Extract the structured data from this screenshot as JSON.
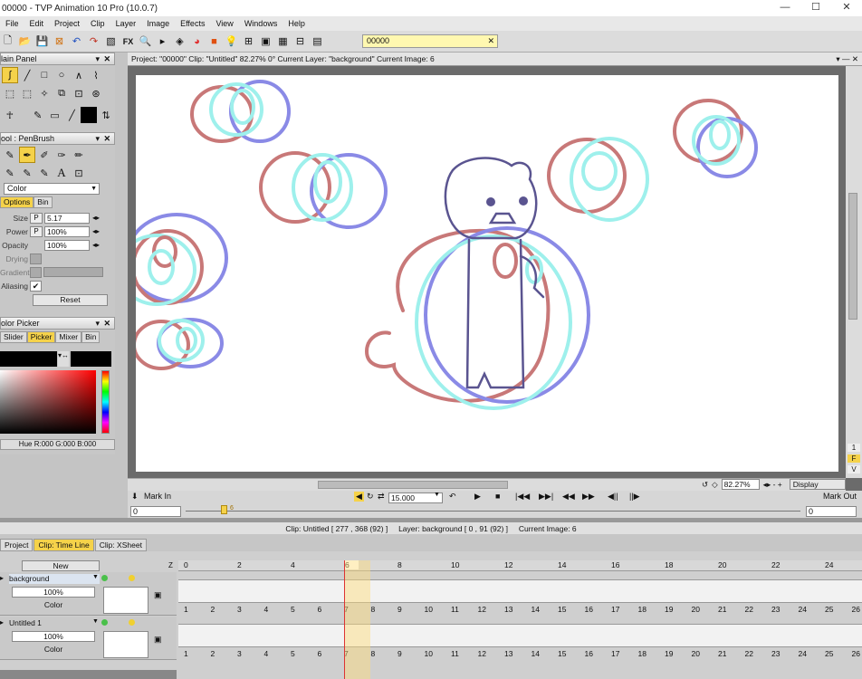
{
  "window": {
    "title": "00000 - TVP Animation 10 Pro (10.0.7)"
  },
  "menu": [
    "File",
    "Edit",
    "Project",
    "Clip",
    "Layer",
    "Image",
    "Effects",
    "View",
    "Windows",
    "Help"
  ],
  "toolbar": {
    "fx_label": "FX",
    "project_field": "00000"
  },
  "main_panel": {
    "title": "lain Panel"
  },
  "tool_panel": {
    "title": "ool : PenBrush",
    "color_mode": "Color",
    "tabs": [
      "Options",
      "Bin"
    ],
    "options": {
      "size_label": "Size",
      "size_value": "5.17",
      "power_label": "Power",
      "power_value": "100%",
      "opacity_label": "Opacity",
      "opacity_value": "100%",
      "drying_label": "Drying",
      "gradient_label": "Gradient",
      "aliasing_label": "Aliasing",
      "reset_label": "Reset"
    },
    "p_badge": "P"
  },
  "color_picker": {
    "title": "olor Picker",
    "tabs": [
      "Slider",
      "Picker",
      "Mixer",
      "Bin"
    ],
    "readout": "Hue R:000 G:000 B:000"
  },
  "viewport": {
    "header": "Project: \"00000\" Clip: \"Untitled\"  82.27%  0°  Current Layer: \"background\"  Current Image: 6",
    "zoom": "82.27%",
    "display": "Display",
    "side_markers": [
      "1",
      "F",
      "V"
    ]
  },
  "playback": {
    "mark_in": "Mark In",
    "mark_out": "Mark Out",
    "fps": "15.000",
    "frame_start": "0",
    "frame_end": "0",
    "current_frame": "6"
  },
  "status": {
    "clip": "Clip: Untitled [ 277 , 368  (92) ]",
    "layer": "Layer: background [ 0 , 91  (92) ]",
    "image": "Current Image: 6"
  },
  "timeline_tabs": [
    "Project",
    "Clip: Time Line",
    "Clip: XSheet"
  ],
  "timeline": {
    "new_label": "New",
    "z_label": "Z",
    "ruler": [
      "0",
      "2",
      "4",
      "6",
      "8",
      "10",
      "12",
      "14",
      "16",
      "18",
      "20",
      "22",
      "24"
    ],
    "frames": [
      "1",
      "2",
      "3",
      "4",
      "5",
      "6",
      "7",
      "8",
      "9",
      "10",
      "11",
      "12",
      "13",
      "14",
      "15",
      "16",
      "17",
      "18",
      "19",
      "20",
      "21",
      "22",
      "23",
      "24",
      "25",
      "26"
    ],
    "layers": [
      {
        "name": "background",
        "opacity": "100%",
        "mode": "Color"
      },
      {
        "name": "Untitled 1",
        "opacity": "100%",
        "mode": "Color"
      }
    ]
  },
  "colors": {
    "accent": "#f5d24a",
    "stroke_red": "#c87878",
    "stroke_blue": "#8a8ae6",
    "stroke_cyan": "#9ef0ec",
    "stroke_figure": "#5a5490"
  }
}
